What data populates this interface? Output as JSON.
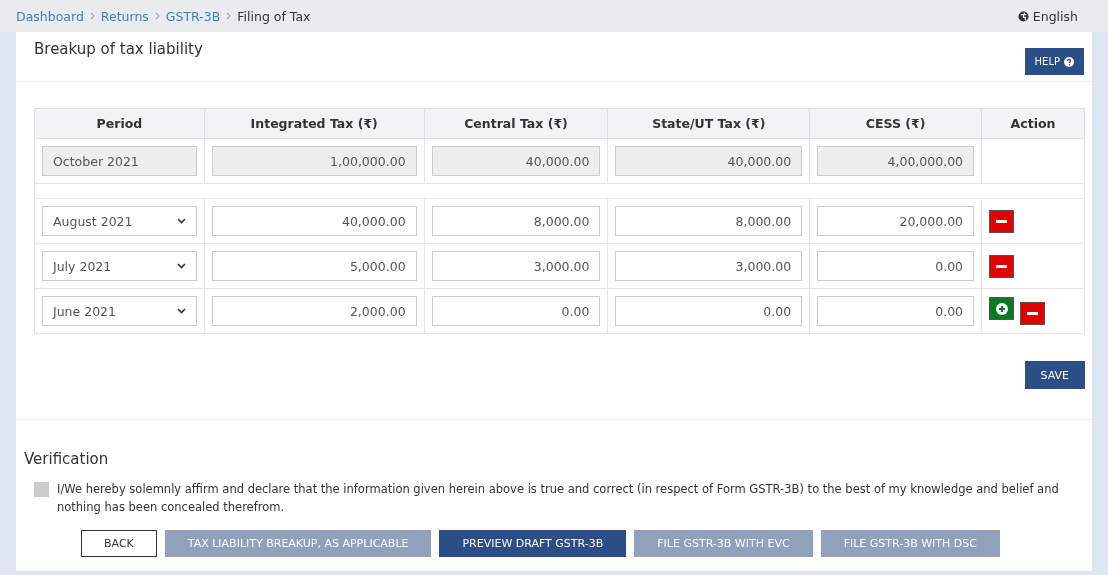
{
  "breadcrumb": [
    {
      "label": "Dashboard",
      "link": true
    },
    {
      "label": "Returns",
      "link": true
    },
    {
      "label": "GSTR-3B",
      "link": true
    },
    {
      "label": "Filing of Tax",
      "link": false
    }
  ],
  "language": "English",
  "title": "Breakup of tax liability",
  "help_button": "HELP",
  "table": {
    "columns": [
      "Period",
      "Integrated Tax (₹)",
      "Central Tax (₹)",
      "State/UT Tax (₹)",
      "CESS (₹)",
      "Action"
    ],
    "summary_row": {
      "period": "October 2021",
      "values": [
        "1,00,000.00",
        "40,000.00",
        "40,000.00",
        "4,00,000.00"
      ]
    },
    "rows": [
      {
        "period": "August 2021",
        "values": [
          "40,000.00",
          "8,000.00",
          "8,000.00",
          "20,000.00"
        ],
        "add_button": false
      },
      {
        "period": "July 2021",
        "values": [
          "5,000.00",
          "3,000.00",
          "3,000.00",
          "0.00"
        ],
        "add_button": false
      },
      {
        "period": "June 2021",
        "values": [
          "2,000.00",
          "0.00",
          "0.00",
          "0.00"
        ],
        "add_button": true
      }
    ]
  },
  "save_button": "SAVE",
  "verification": {
    "title": "Verification",
    "checked": false,
    "text": "I/We hereby solemnly affirm and declare that the information given herein above is true and correct (in respect of Form GSTR-3B) to the best of my knowledge and belief and nothing has been concealed therefrom."
  },
  "buttons": [
    {
      "label": "BACK",
      "kind": "outline"
    },
    {
      "label": "TAX LIABILITY BREAKUP, AS APPLICABLE",
      "kind": "disabled"
    },
    {
      "label": "PREVIEW DRAFT GSTR-3B",
      "kind": "primary"
    },
    {
      "label": "FILE GSTR-3B WITH EVC",
      "kind": "disabled"
    },
    {
      "label": "FILE GSTR-3B WITH DSC",
      "kind": "disabled"
    }
  ]
}
